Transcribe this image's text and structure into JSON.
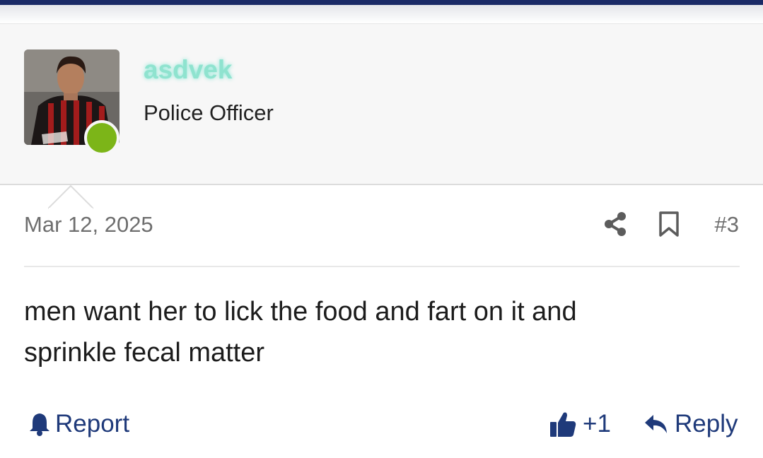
{
  "user": {
    "name": "asdvek",
    "title": "Police Officer",
    "status": "online",
    "name_color": "#8fe3cf",
    "online_color": "#7cb518"
  },
  "post": {
    "date": "Mar 12, 2025",
    "number": "#3",
    "message_lines": [
      "men want her to lick the food and fart on it and",
      "sprinkle fecal matter"
    ]
  },
  "actions": {
    "report_label": "Report",
    "like_label": "+1",
    "reply_label": "Reply",
    "share_icon": "share-icon",
    "bookmark_icon": "bookmark-icon"
  },
  "colors": {
    "accent": "#1f3a7a",
    "top_bar": "#1a2a66"
  }
}
